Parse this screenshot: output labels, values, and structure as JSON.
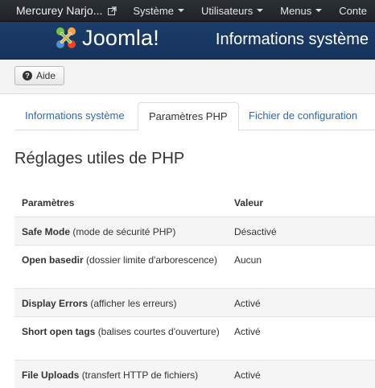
{
  "topbar": {
    "site_name": "Mercurey Narjo...",
    "menu": [
      "Système",
      "Utilisateurs",
      "Menus",
      "Conte"
    ]
  },
  "header": {
    "logo_text": "Joomla!",
    "title": "Informations système"
  },
  "toolbar": {
    "help_label": "Aide"
  },
  "tabs": [
    {
      "label": "Informations système",
      "active": false
    },
    {
      "label": "Paramètres PHP",
      "active": true
    },
    {
      "label": "Fichier de configuration",
      "active": false
    }
  ],
  "section": {
    "title": "Réglages utiles de PHP"
  },
  "table": {
    "headers": [
      "Paramètres",
      "Valeur"
    ],
    "rows": [
      {
        "name": "Safe Mode",
        "desc": "(mode de sécurité PHP)",
        "value": "Désactivé"
      },
      {
        "name": "Open basedir",
        "desc": "(dossier limite d'arborescence)",
        "value": "Aucun"
      },
      {
        "name": "Display Errors",
        "desc": "(afficher les erreurs)",
        "value": "Activé"
      },
      {
        "name": "Short open tags",
        "desc": "(balises courtes d'ouverture)",
        "value": "Activé"
      },
      {
        "name": "File Uploads",
        "desc": "(transfert HTTP de fichiers)",
        "value": "Activé"
      }
    ]
  },
  "colors": {
    "topbar_bg": "#1f2327",
    "header_bg": "#16335c",
    "link": "#2a69b8",
    "row_alt": "#f5f5f5"
  },
  "icons": [
    "external-link-icon",
    "caret-down-icon",
    "joomla-logo-icon",
    "question-circle-icon"
  ]
}
